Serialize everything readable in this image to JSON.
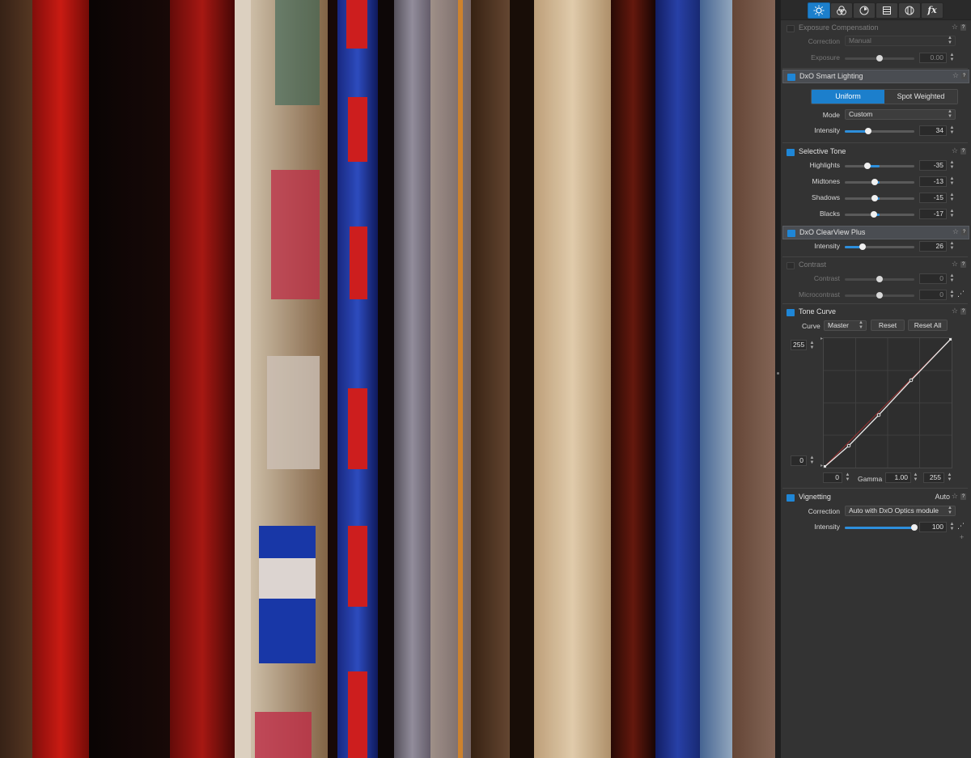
{
  "toolbar": {
    "icons": [
      "light-icon",
      "color-icon",
      "detail-icon",
      "geometry-icon",
      "local-adjust-icon",
      "effects-icon"
    ],
    "fx_label": "fx"
  },
  "exposure": {
    "title": "Exposure Compensation",
    "correction_label": "Correction",
    "correction_value": "Manual",
    "exposure_label": "Exposure",
    "exposure_value": "0.00",
    "exposure_fraction": 0.5
  },
  "smart_lighting": {
    "title": "DxO Smart Lighting",
    "tab_uniform": "Uniform",
    "tab_spot": "Spot Weighted",
    "mode_label": "Mode",
    "mode_value": "Custom",
    "intensity_label": "Intensity",
    "intensity_value": "34",
    "intensity_fraction": 0.34
  },
  "selective_tone": {
    "title": "Selective Tone",
    "rows": [
      {
        "label": "Highlights",
        "value": "-35",
        "fraction": 0.325
      },
      {
        "label": "Midtones",
        "value": "-13",
        "fraction": 0.435
      },
      {
        "label": "Shadows",
        "value": "-15",
        "fraction": 0.425
      },
      {
        "label": "Blacks",
        "value": "-17",
        "fraction": 0.415
      }
    ]
  },
  "clearview": {
    "title": "DxO ClearView Plus",
    "intensity_label": "Intensity",
    "intensity_value": "26",
    "intensity_fraction": 0.26
  },
  "contrast": {
    "title": "Contrast",
    "contrast_label": "Contrast",
    "contrast_value": "0",
    "micro_label": "Microcontrast",
    "micro_value": "0",
    "fraction": 0.5
  },
  "tone_curve": {
    "title": "Tone Curve",
    "curve_label": "Curve",
    "curve_value": "Master",
    "reset": "Reset",
    "reset_all": "Reset All",
    "out_max": "255",
    "out_min": "0",
    "in_min": "0",
    "gamma_label": "Gamma",
    "gamma_value": "1.00",
    "in_max": "255"
  },
  "vignetting": {
    "title": "Vignetting",
    "auto_label": "Auto",
    "correction_label": "Correction",
    "correction_value": "Auto with DxO Optics module",
    "intensity_label": "Intensity",
    "intensity_value": "100",
    "intensity_fraction": 1.0
  },
  "colors": {
    "accent": "#1c7fcc",
    "panel": "#333333"
  }
}
